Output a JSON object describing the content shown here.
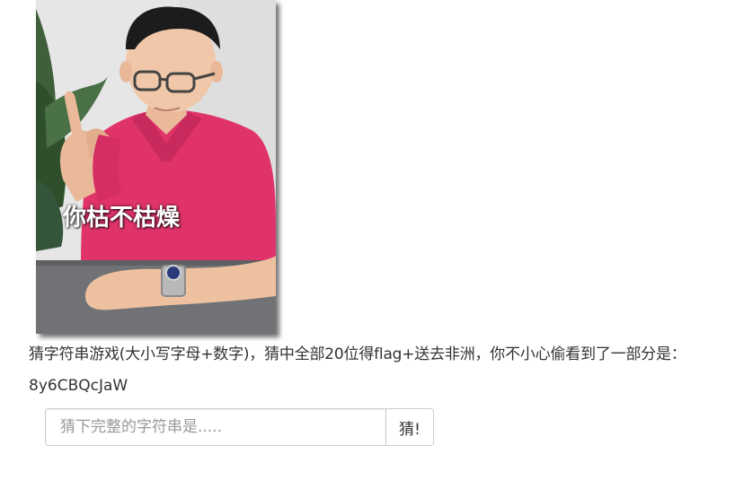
{
  "meme": {
    "caption": "你枯不枯燥"
  },
  "hint_text": "猜字符串游戏(大小写字母+数字)，猜中全部20位得flag+送去非洲，你不小心偷看到了一部分是：",
  "partial_string": "8y6CBQcJaW",
  "form": {
    "input_value": "",
    "input_placeholder": "猜下完整的字符串是.....",
    "button_label": "猜!"
  },
  "colors": {
    "shirt": "#e0336a",
    "table": "#707275",
    "wall": "#e4e4e4",
    "text": "#333333",
    "border": "#cccccc"
  }
}
